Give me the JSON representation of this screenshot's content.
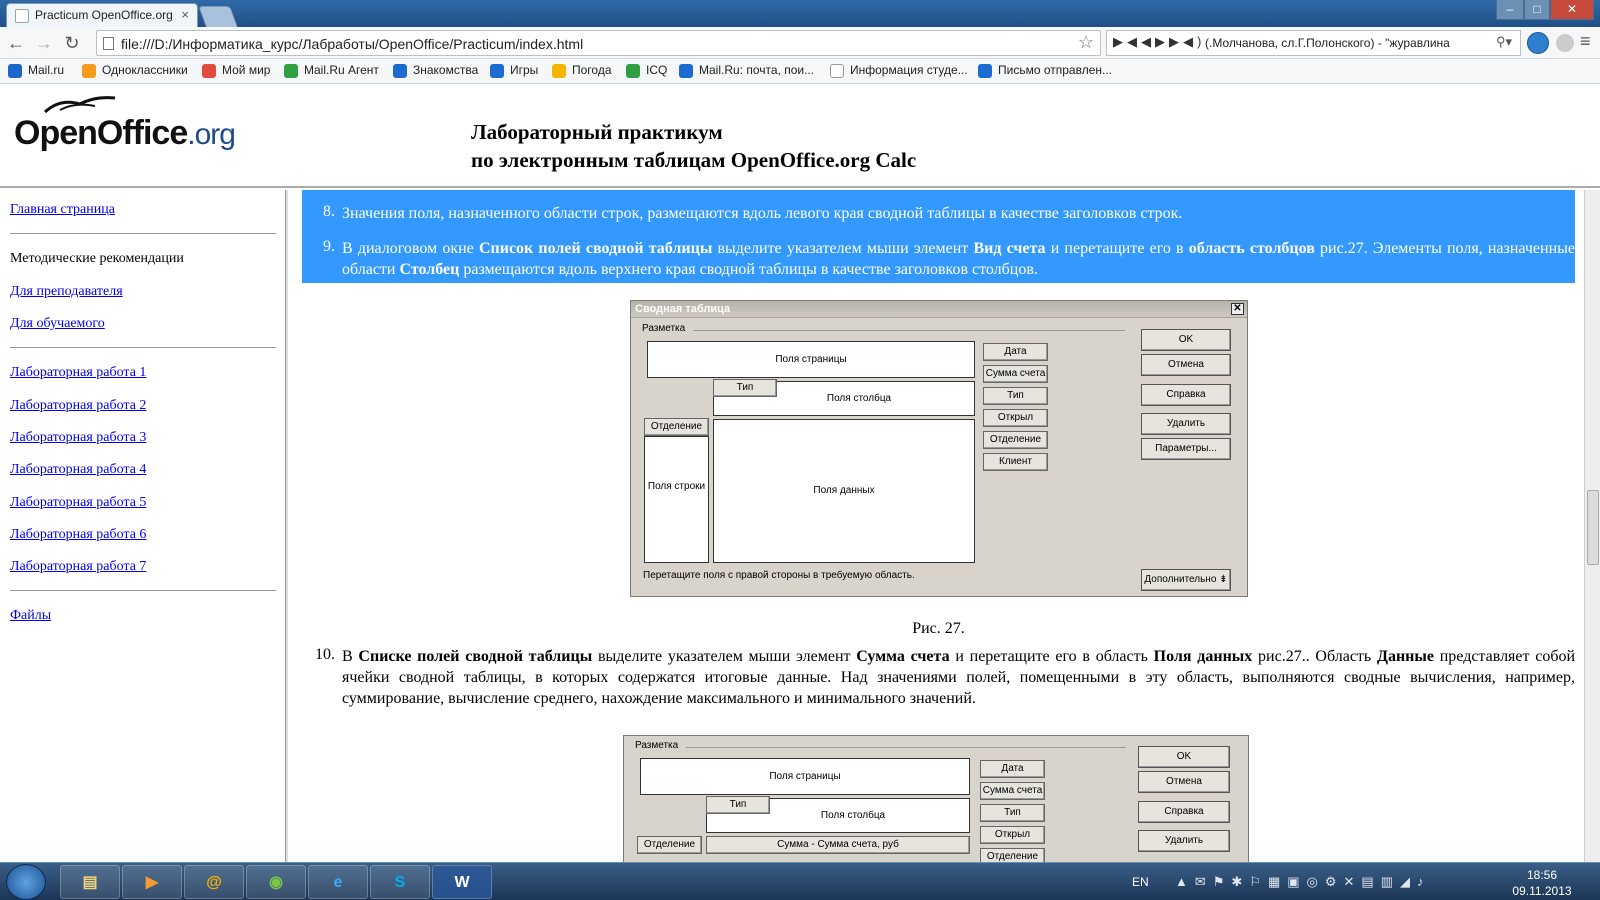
{
  "browser": {
    "tab_title": "Practicum OpenOffice.org",
    "url": "file:///D:/Информатика_курс/Лабработы/OpenOffice/Practicum/index.html",
    "media_text": "(.Молчанова, сл.Г.Полонского) - \"журавлина"
  },
  "bookmarks": [
    {
      "label": "Mail.ru",
      "color": "#1a66c9"
    },
    {
      "label": "Одноклассники",
      "color": "#f59a1d"
    },
    {
      "label": "Мой мир",
      "color": "#e34b3c"
    },
    {
      "label": "Mail.Ru Агент",
      "color": "#2ea043"
    },
    {
      "label": "Знакомства",
      "color": "#1d6bd1"
    },
    {
      "label": "Игры",
      "color": "#1d6bd1"
    },
    {
      "label": "Погода",
      "color": "#f7b500"
    },
    {
      "label": "ICQ",
      "color": "#2ea043"
    },
    {
      "label": "Mail.Ru: почта, пои...",
      "color": "#1d6bd1"
    },
    {
      "label": "Информация студе...",
      "color": "#dddddd"
    },
    {
      "label": "Письмо отправлен...",
      "color": "#1d6bd1"
    }
  ],
  "header": {
    "logo_main": "OpenOffice",
    "logo_suffix": ".org",
    "title_line1": "Лабораторный практикум",
    "title_line2": "по электронным таблицам OpenOffice.org Calc"
  },
  "sidebar": {
    "home": "Главная страница",
    "methods": "Методические рекомендации",
    "teacher": "Для преподавателя",
    "student": "Для обучаемого",
    "labs": [
      "Лабораторная работа 1",
      "Лабораторная работа 2",
      "Лабораторная работа 3",
      "Лабораторная работа 4",
      "Лабораторная работа 5",
      "Лабораторная работа 6",
      "Лабораторная работа 7"
    ],
    "files": "Файлы"
  },
  "content": {
    "n8": "8.",
    "p8": "Значения поля, назначенного области строк, размещаются вдоль левого края сводной таблицы в качестве заголовков строк.",
    "n9": "9.",
    "p9": {
      "t1": "В диалоговом окне ",
      "b1": "Список полей сводной таблицы",
      "t2": " выделите указателем мыши элемент ",
      "b2": "Вид счета",
      "t3": " и перетащите его в ",
      "b3": "область столбцов",
      "t4": " рис.27. Элементы поля, назначенные области ",
      "b4": "Столбец",
      "t5": " размещаются вдоль верхнего края сводной таблицы в качестве заголовков столбцов."
    },
    "caption27": "Рис. 27.",
    "n10": "10.",
    "p10": {
      "t1": "В ",
      "b1": "Списке полей сводной таблицы",
      "t2": " выделите указателем мыши элемент ",
      "b2": "Сумма счета",
      "t3": " и перетащите его в область ",
      "b3": "Поля данных",
      "t4": " рис.27.. Область ",
      "b4": "Данные",
      "t5": " представляет собой ячейки сводной таблицы, в которых содержатся итоговые данные. Над значениями полей, помещенными в эту область, выполняются сводные вычисления, например, суммирование, вычисление среднего, нахождение максимального и минимального значений."
    }
  },
  "dialog1": {
    "title": "Сводная таблица",
    "group": "Разметка",
    "page_fields": "Поля страницы",
    "col_tag": "Тип",
    "col_fields": "Поля столбца",
    "row_tag": "Отделение",
    "row_fields": "Поля строки",
    "data_fields": "Поля данных",
    "hint": "Перетащите поля с правой стороны в требуемую область.",
    "fields": [
      "Дата",
      "Сумма счета",
      "Тип",
      "Открыл",
      "Отделение",
      "Клиент"
    ],
    "buttons": {
      "ok": "OK",
      "cancel": "Отмена",
      "help": "Справка",
      "delete": "Удалить",
      "options": "Параметры...",
      "more": "Дополнительно"
    }
  },
  "dialog2": {
    "group": "Разметка",
    "page_fields": "Поля страницы",
    "col_tag": "Тип",
    "col_fields": "Поля столбца",
    "row_tag": "Отделение",
    "data_tag": "Сумма - Сумма счета, руб",
    "fields": [
      "Дата",
      "Сумма счета",
      "Тип",
      "Открыл",
      "Отделение"
    ],
    "buttons": {
      "ok": "OK",
      "cancel": "Отмена",
      "help": "Справка",
      "delete": "Удалить"
    }
  },
  "taskbar": {
    "lang": "EN",
    "time": "18:56",
    "date": "09.11.2013"
  }
}
